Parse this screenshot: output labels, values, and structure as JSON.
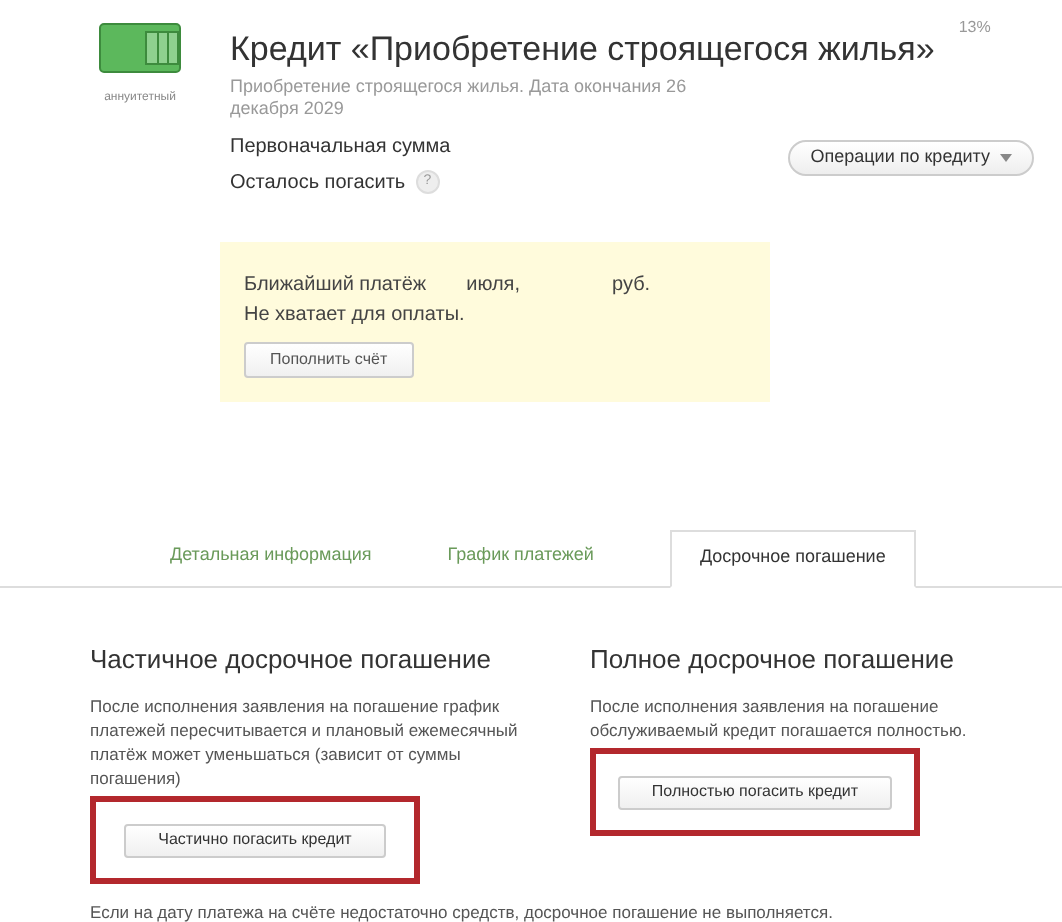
{
  "credit": {
    "badge": "аннуитетный",
    "title": "Кредит «Приобретение строящегося жилья»",
    "rate": "13%",
    "subtitle": "Приобретение строящегося жилья. Дата окончания 26 декабря 2029",
    "fields": [
      {
        "label": "Первоначальная сумма",
        "help": false
      },
      {
        "label": "Осталось погасить",
        "help": true
      }
    ],
    "help_mark": "?",
    "operations_button": "Операции по кредиту"
  },
  "notice": {
    "parts": [
      "Ближайший платёж",
      "июля,",
      "руб."
    ],
    "line2": "Не хватает для оплаты.",
    "button": "Пополнить счёт"
  },
  "tabs": [
    {
      "label": "Детальная информация",
      "selected": false
    },
    {
      "label": "График платежей",
      "selected": false
    },
    {
      "label": "Досрочное погашение",
      "selected": true
    }
  ],
  "sections": [
    {
      "title": "Частичное досрочное погашение",
      "text": "После исполнения заявления на погашение график платежей пересчитывается и плановый ежемесячный платёж может уменьшаться (зависит от суммы погашения)",
      "button": "Частично погасить кредит",
      "highlighted": true
    },
    {
      "title": "Полное досрочное погашение",
      "text": "После исполнения заявления на погашение обслуживаемый кредит погашается полностью.",
      "button": "Полностью погасить кредит",
      "highlighted": true
    }
  ],
  "footer": "Если на дату платежа на счёте недостаточно средств, досрочное погашение не выполняется."
}
